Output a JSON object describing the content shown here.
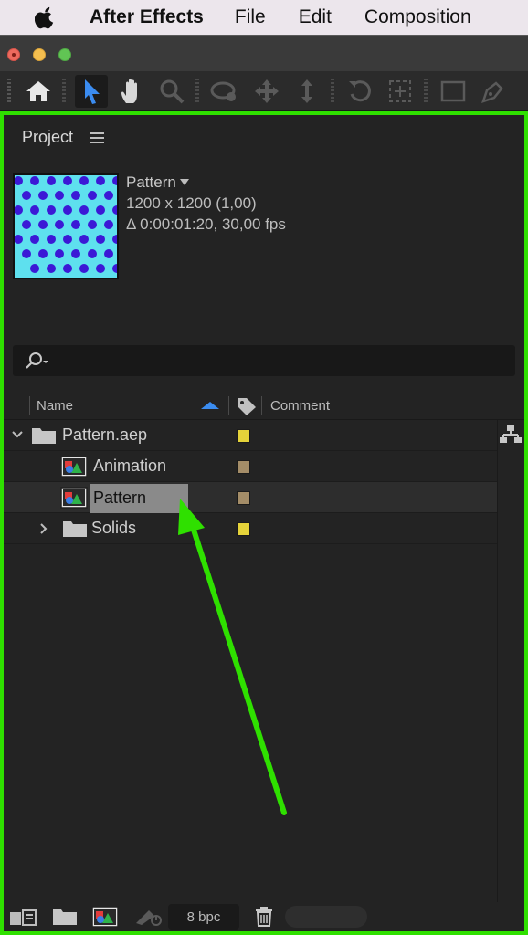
{
  "menubar": {
    "app_name": "After Effects",
    "items": [
      "File",
      "Edit",
      "Composition"
    ]
  },
  "toolbar": {
    "tools": [
      "home-icon",
      "selection-tool-icon",
      "hand-tool-icon",
      "zoom-tool-icon",
      "orbit-camera-icon",
      "pan-camera-icon",
      "dolly-camera-icon",
      "rotate-tool-icon",
      "anchor-point-icon",
      "rectangle-tool-icon",
      "pen-tool-icon"
    ],
    "active_tool": "selection-tool-icon",
    "accent": "#3b8cf0"
  },
  "project": {
    "title": "Project",
    "preview": {
      "name": "Pattern",
      "dimensions": "1200 x 1200 (1,00)",
      "duration": "Δ 0:00:01:20, 30,00 fps",
      "thumb_bg": "#5ee0ee",
      "dot_color": "#3b19d6"
    },
    "search": {
      "placeholder": ""
    },
    "columns": {
      "name": "Name",
      "comment": "Comment"
    },
    "items": [
      {
        "label": "Pattern.aep",
        "type": "folder",
        "expanded": true,
        "label_color": "#e5d33a"
      },
      {
        "label": "Animation",
        "type": "composition",
        "label_color": "#a48d68"
      },
      {
        "label": "Pattern",
        "type": "composition",
        "selected": true,
        "label_color": "#a48d68"
      },
      {
        "label": "Solids",
        "type": "folder",
        "expanded": false,
        "label_color": "#e5d33a"
      }
    ],
    "footer": {
      "bit_depth": "8 bpc"
    }
  },
  "annotation": {
    "highlight_color": "#2fe000"
  }
}
